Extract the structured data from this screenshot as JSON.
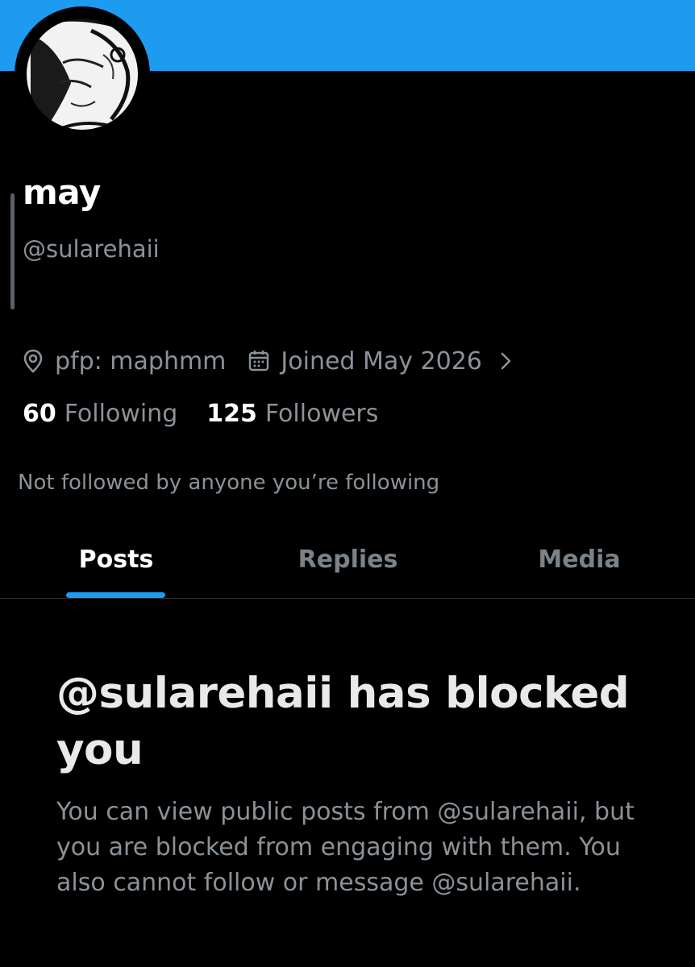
{
  "profile": {
    "display_name": "may",
    "handle": "@sularehaii",
    "location": "pfp: maphmm",
    "joined": "Joined May 2026",
    "following_count": "60",
    "following_label": "Following",
    "followers_count": "125",
    "followers_label": "Followers",
    "not_followed_note": "Not followed by anyone you’re following"
  },
  "tabs": [
    {
      "label": "Posts",
      "active": true
    },
    {
      "label": "Replies",
      "active": false
    },
    {
      "label": "Media",
      "active": false
    }
  ],
  "blocked": {
    "title": "@sularehaii has blocked you",
    "body": "You can view public posts from @sularehaii, but you are blocked from engaging with them. You also cannot follow or message @sularehaii."
  },
  "icons": {
    "location": "location-pin-icon",
    "calendar": "calendar-icon",
    "chevron": "chevron-right-icon"
  },
  "colors": {
    "banner": "#1d9bf0",
    "accent": "#1d9bf0",
    "background": "#000000",
    "primary_text": "#e7e9ea",
    "secondary_text": "#8b9298"
  }
}
